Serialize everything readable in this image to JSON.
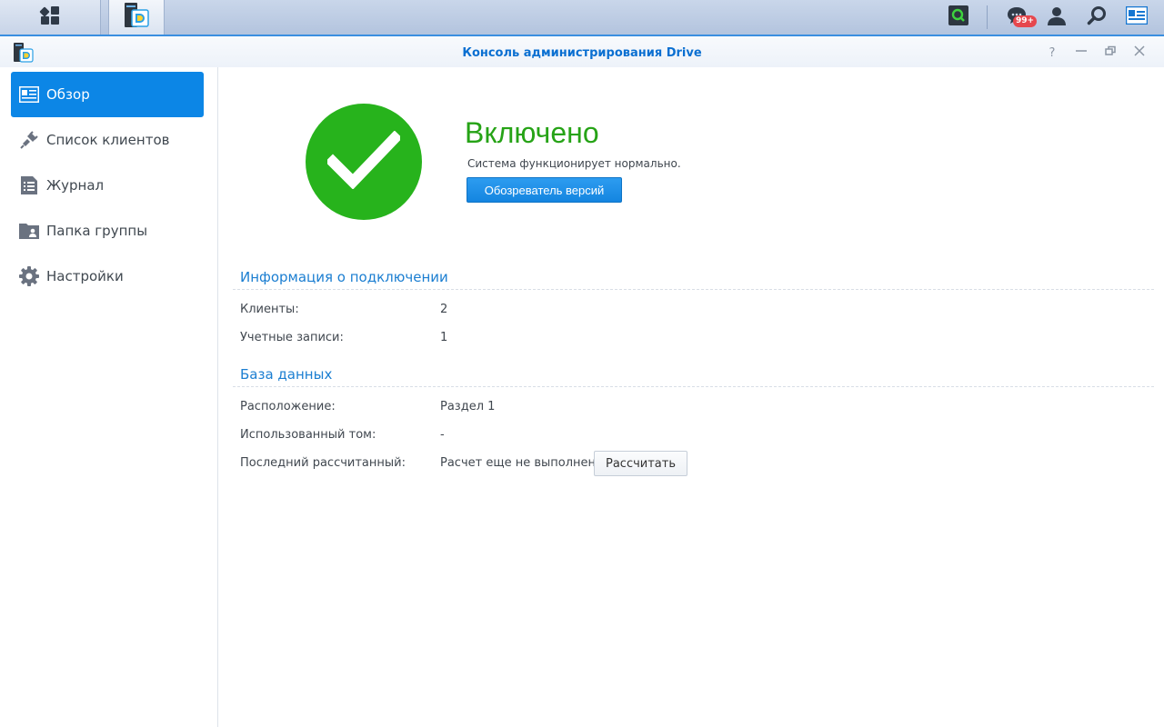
{
  "taskbar": {
    "notification_count": "99+"
  },
  "window": {
    "title": "Консоль администрирования Drive",
    "controls": [
      "help",
      "minimize",
      "restore",
      "close"
    ]
  },
  "sidebar": {
    "items": [
      {
        "label": "Обзор",
        "icon": "overview-icon",
        "active": true
      },
      {
        "label": "Список клиентов",
        "icon": "plug-icon",
        "active": false
      },
      {
        "label": "Журнал",
        "icon": "log-icon",
        "active": false
      },
      {
        "label": "Папка группы",
        "icon": "team-folder-icon",
        "active": false
      },
      {
        "label": "Настройки",
        "icon": "gear-icon",
        "active": false
      }
    ]
  },
  "status": {
    "title": "Включено",
    "description": "Система функционирует нормально.",
    "button_label": "Обозреватель версий"
  },
  "connection": {
    "section_title": "Информация о подключении",
    "rows": [
      {
        "label": "Клиенты:",
        "value": "2"
      },
      {
        "label": "Учетные записи:",
        "value": "1"
      }
    ]
  },
  "database": {
    "section_title": "База данных",
    "rows": [
      {
        "label": "Расположение:",
        "value": "Раздел 1"
      },
      {
        "label": "Использованный том:",
        "value": "-"
      },
      {
        "label": "Последний рассчитанный:",
        "value": "Расчет еще не выполнен"
      }
    ],
    "calculate_label": "Рассчитать"
  },
  "colors": {
    "accent": "#0c86e6",
    "success": "#27b31c",
    "section_title": "#1b7ed1",
    "badge": "#e6474d"
  }
}
